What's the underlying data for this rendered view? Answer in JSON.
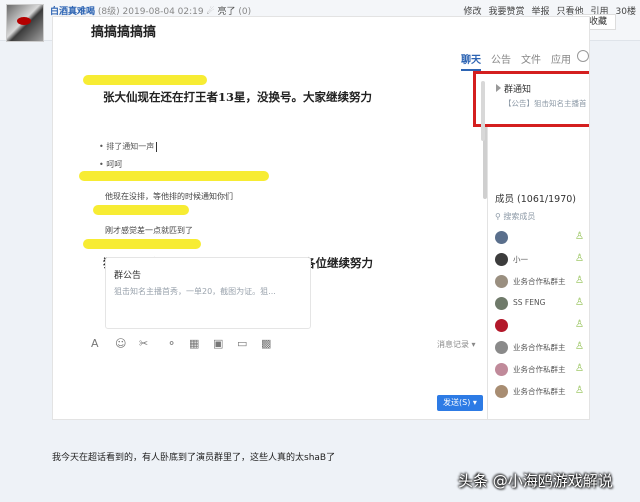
{
  "post": {
    "username": "白酒真难喝",
    "level": "(8级)",
    "timestamp": "2019-08-04 02:19",
    "like_label": "亮了",
    "like_count": "(0)",
    "actions": [
      "修改",
      "我要赞赏",
      "举报",
      "只看他",
      "引用",
      "30楼"
    ],
    "favorite_label": "收藏",
    "caption": "我今天在超话看到的，有人卧底到了演员群里了，这些人真的太shaB了",
    "watermark": "头条 @小海鸥游戏解说"
  },
  "screenshot": {
    "group_title": "搞搞搞搞搞",
    "tabs": [
      "聊天",
      "公告",
      "文件",
      "应用"
    ],
    "messages": [
      {
        "text": "张大仙现在还在打王者13星，没换号。大家继续努力",
        "style": "big"
      },
      {
        "text": "• 排了通知一声",
        "style": "bullet"
      },
      {
        "text": "• 呵呵",
        "style": "bullet"
      },
      {
        "text": "他现在没排，等他排的时候通知你们",
        "style": "small"
      },
      {
        "text": "刚才感觉差一点就匹到了",
        "style": "small"
      },
      {
        "text": "狙击一单辛苦费20，狙击成功300块，各位继续努力",
        "style": "big"
      }
    ],
    "notice_card": {
      "title": "群公告",
      "desc": "狙击知名主播首秀，一单20，截图为证。狙..."
    },
    "history_label": "消息记录",
    "send_label": "发送(S)",
    "group_notice": {
      "title": "群通知",
      "desc": "【公告】狙击知名主播首..."
    },
    "members_title": "成员 (1061/1970)",
    "search_placeholder": "搜索成员",
    "members": [
      {
        "name": ""
      },
      {
        "name": "小一"
      },
      {
        "name": "业务合作私群主"
      },
      {
        "name": "SS  FENG"
      },
      {
        "name": ""
      },
      {
        "name": "业务合作私群主"
      },
      {
        "name": "业务合作私群主"
      },
      {
        "name": "业务合作私群主"
      }
    ]
  }
}
